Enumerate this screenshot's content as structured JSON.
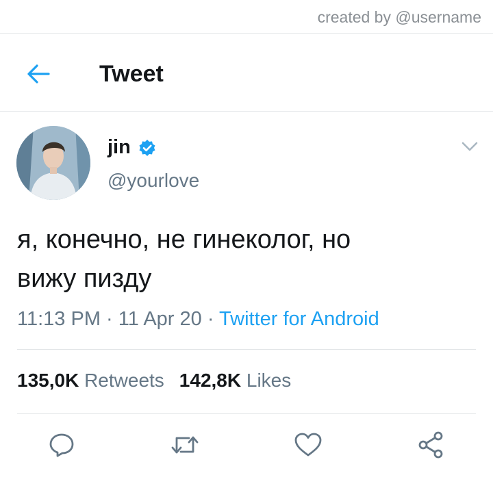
{
  "watermark": "created by @username",
  "header": {
    "title": "Tweet",
    "back_icon": "arrow-left-icon"
  },
  "tweet": {
    "author_name": "jin",
    "verified_icon": "verified-badge-icon",
    "handle": "@yourlove",
    "text_line1": "я, конечно, не гинеколог, но",
    "text_line2": "вижу пизду",
    "time": "11:13 PM",
    "date": "11 Apr 20",
    "separator": " · ",
    "source": "Twitter for Android"
  },
  "stats": {
    "retweets_count": "135,0K",
    "retweets_label": "Retweets",
    "likes_count": "142,8K",
    "likes_label": "Likes"
  },
  "actions": [
    "reply-icon",
    "retweet-icon",
    "like-icon",
    "share-icon"
  ],
  "colors": {
    "accent": "#1da1f2",
    "muted": "#657786",
    "text": "#14171a",
    "divider": "#e3e6e8"
  }
}
